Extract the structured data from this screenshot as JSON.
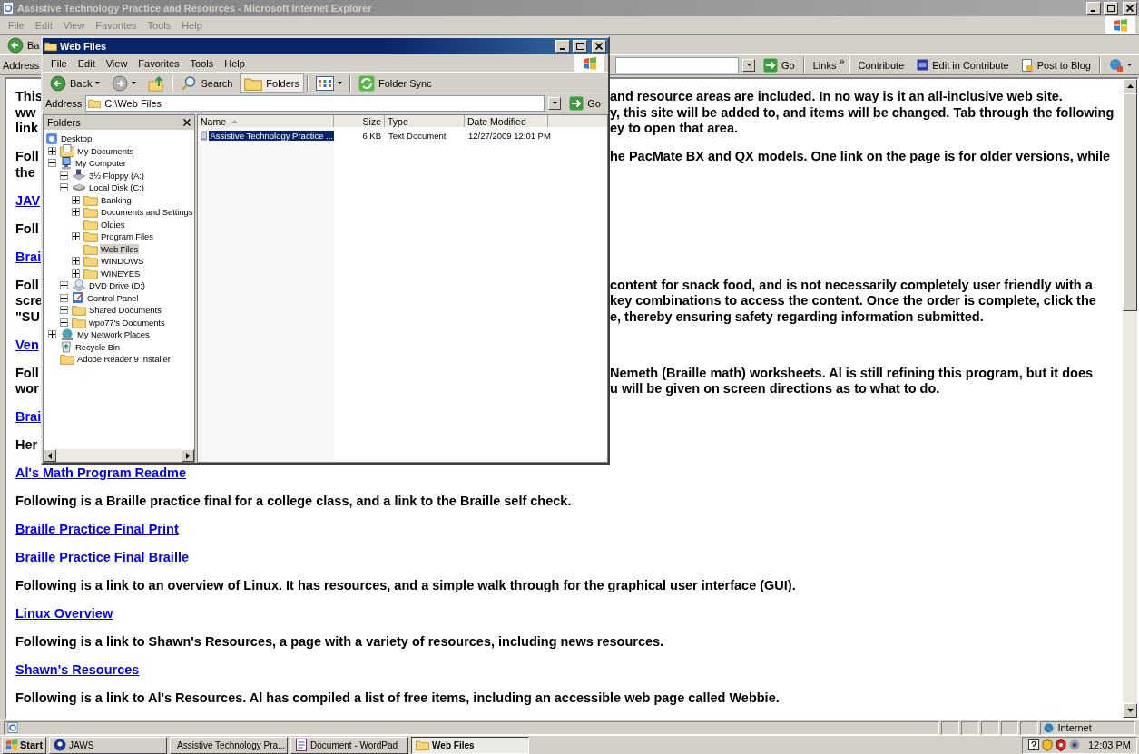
{
  "ie": {
    "title": "Assistive Technology Practice and Resources - Microsoft Internet Explorer",
    "menu": [
      "File",
      "Edit",
      "View",
      "Favorites",
      "Tools",
      "Help"
    ],
    "back_label": "Ba",
    "address_label": "Address",
    "go": "Go",
    "links": "Links",
    "links_chevron": "»",
    "toolbar_links": [
      {
        "label": "Contribute",
        "kind": "plain"
      },
      {
        "label": "Edit in Contribute",
        "kind": "contribute"
      },
      {
        "label": "Post to Blog",
        "kind": "blog"
      }
    ]
  },
  "page": {
    "blocks": [
      {
        "kind": "text",
        "lines": [
          {
            "left": "This",
            "right": "and resource areas are included. In no way is it an all-inclusive web site."
          },
          {
            "left": "ww",
            "right": "y, this site will be added to, and items will be changed. Tab through the following"
          },
          {
            "left": "link",
            "right": "ey to open that area."
          }
        ]
      },
      {
        "kind": "text",
        "lines": [
          {
            "left": "Foll",
            "right": "he PacMate BX and QX models. One link on the page is for older versions, while"
          },
          {
            "left": "the"
          }
        ]
      },
      {
        "kind": "link",
        "lines": [
          {
            "left": "JAV"
          }
        ]
      },
      {
        "kind": "text",
        "lines": [
          {
            "left": "Foll"
          }
        ]
      },
      {
        "kind": "link",
        "lines": [
          {
            "left": "Brai"
          }
        ]
      },
      {
        "kind": "text",
        "lines": [
          {
            "left": "Foll",
            "right": "content for snack food, and is not necessarily completely user friendly with a"
          },
          {
            "left": "scre",
            "right": "key combinations to access the content. Once the order is complete, click the"
          },
          {
            "left": "\"SU",
            "right": "e, thereby ensuring safety regarding information submitted."
          }
        ]
      },
      {
        "kind": "link",
        "lines": [
          {
            "left": "Ven"
          }
        ]
      },
      {
        "kind": "text",
        "lines": [
          {
            "left": "Foll",
            "right": "Nemeth (Braille math) worksheets. Al is still refining this program, but it does"
          },
          {
            "left": "wor",
            "right": "u will be given on screen directions as to what to do."
          }
        ]
      },
      {
        "kind": "link",
        "lines": [
          {
            "left": "Brai"
          }
        ]
      },
      {
        "kind": "text",
        "lines": [
          {
            "left": "Her"
          }
        ]
      },
      {
        "kind": "link",
        "lines": [
          {
            "text": "Al's Math Program Readme"
          }
        ]
      },
      {
        "kind": "text",
        "lines": [
          {
            "text": "Following is a Braille practice final for a college class, and a link to the Braille self check."
          }
        ]
      },
      {
        "kind": "link",
        "lines": [
          {
            "text": "Braille Practice Final Print"
          }
        ]
      },
      {
        "kind": "link",
        "lines": [
          {
            "text": "Braille Practice Final Braille"
          }
        ]
      },
      {
        "kind": "text",
        "lines": [
          {
            "text": "Following is a link to an overview of Linux. It has resources, and a simple walk through for the graphical user interface (GUI)."
          }
        ]
      },
      {
        "kind": "link",
        "lines": [
          {
            "text": "Linux Overview"
          }
        ]
      },
      {
        "kind": "text",
        "lines": [
          {
            "text": "Following is a link to Shawn's Resources, a page with a variety of resources, including news resources."
          }
        ]
      },
      {
        "kind": "link",
        "lines": [
          {
            "text": "Shawn's Resources"
          }
        ]
      },
      {
        "kind": "text",
        "lines": [
          {
            "text": "Following is a link to Al's Resources. Al has compiled a list of free items, including an accessible web page called Webbie."
          }
        ]
      }
    ]
  },
  "explorer": {
    "title": "Web Files",
    "menu": [
      "File",
      "Edit",
      "View",
      "Favorites",
      "Tools",
      "Help"
    ],
    "toolbar": {
      "back": "Back",
      "search": "Search",
      "folders": "Folders",
      "folders_selected": true,
      "sync": "Folder Sync"
    },
    "address_label": "Address",
    "address": "C:\\Web Files",
    "go": "Go",
    "folders_title": "Folders",
    "tree": [
      {
        "label": "Desktop",
        "kind": "desktop",
        "selected": false,
        "children": [
          {
            "label": "My Documents",
            "kind": "documents",
            "expanded": false,
            "selected": false
          },
          {
            "label": "My Computer",
            "kind": "computer",
            "expanded": true,
            "selected": false,
            "children": [
              {
                "label": "3½ Floppy (A:)",
                "kind": "floppy",
                "expanded": false,
                "selected": false
              },
              {
                "label": "Local Disk (C:)",
                "kind": "disk",
                "expanded": true,
                "selected": false,
                "children": [
                  {
                    "label": "Banking",
                    "kind": "folder",
                    "expanded": false,
                    "selected": false
                  },
                  {
                    "label": "Documents and Settings",
                    "kind": "folder",
                    "expanded": false,
                    "selected": false
                  },
                  {
                    "label": "Oldies",
                    "kind": "folder",
                    "selected": false
                  },
                  {
                    "label": "Program Files",
                    "kind": "folder",
                    "expanded": false,
                    "selected": false
                  },
                  {
                    "label": "Web Files",
                    "kind": "folder",
                    "selected": true
                  },
                  {
                    "label": "WINDOWS",
                    "kind": "folder",
                    "expanded": false,
                    "selected": false
                  },
                  {
                    "label": "WINEYES",
                    "kind": "folder",
                    "expanded": false,
                    "selected": false
                  }
                ]
              },
              {
                "label": "DVD Drive (D:)",
                "kind": "dvd",
                "expanded": false,
                "selected": false
              },
              {
                "label": "Control Panel",
                "kind": "control",
                "expanded": false,
                "selected": false
              },
              {
                "label": "Shared Documents",
                "kind": "folder",
                "expanded": false,
                "selected": false
              },
              {
                "label": "wpo77's Documents",
                "kind": "folder",
                "expanded": false,
                "selected": false
              }
            ]
          },
          {
            "label": "My Network Places",
            "kind": "network",
            "expanded": false,
            "selected": false
          },
          {
            "label": "Recycle Bin",
            "kind": "recycle",
            "selected": false
          },
          {
            "label": "Adobe Reader 9 Installer",
            "kind": "folder",
            "selected": false
          }
        ]
      }
    ],
    "columns": [
      {
        "label": "Name",
        "sorted": true
      },
      {
        "label": "Size",
        "sorted": false
      },
      {
        "label": "Type",
        "sorted": false
      },
      {
        "label": "Date Modified",
        "sorted": false
      }
    ],
    "files": [
      {
        "name": "Assistive Technology Practice ...",
        "size": "6 KB",
        "type": "Text Document",
        "modified": "12/27/2009 12:01 PM",
        "selected": true
      }
    ]
  },
  "status_bar": {
    "zone": "Internet"
  },
  "taskbar": {
    "start": "Start",
    "buttons": [
      {
        "label": "JAWS",
        "kind": "jaws",
        "selected": false
      },
      {
        "label": "Assistive Technology Pra...",
        "kind": "ie",
        "selected": false
      },
      {
        "label": "Document - WordPad",
        "kind": "wordpad",
        "selected": false
      },
      {
        "label": "Web Files",
        "kind": "folder",
        "selected": true
      }
    ],
    "clock": "12:03 PM"
  }
}
